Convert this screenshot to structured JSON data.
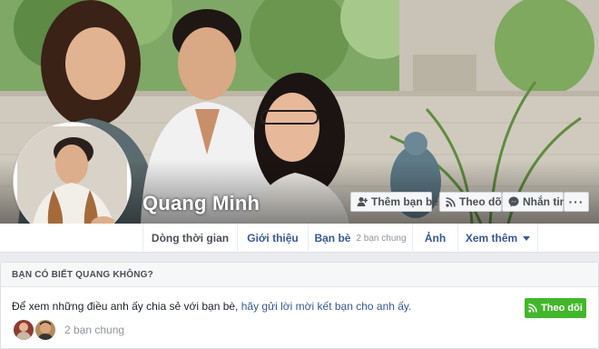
{
  "profile": {
    "name": "Quang Minh"
  },
  "actions": {
    "add_friend": "Thêm bạn bè",
    "follow": "Theo dõi",
    "message": "Nhắn tin",
    "more": "···"
  },
  "nav": {
    "timeline": "Dòng thời gian",
    "about": "Giới thiệu",
    "friends": "Bạn bè",
    "friends_sub": "2 bạn chung",
    "photos": "Ảnh",
    "more": "Xem thêm"
  },
  "card": {
    "title": "BẠN CÓ BIẾT QUANG KHÔNG?",
    "text_prefix": "Để xem những điều anh ấy chia sẻ với bạn bè, ",
    "text_link": "hãy gửi lời mời kết bạn cho anh ấy.",
    "follow_button": "Theo dõi",
    "mutual_text": "2 bạn chung"
  },
  "icons": {
    "add_friend": "add-friend-icon",
    "follow": "rss-follow-icon",
    "message": "messenger-icon",
    "caret": "caret-down-icon"
  },
  "colors": {
    "link": "#365899",
    "follow_green": "#42b72a",
    "page_bg": "#e9ebee"
  }
}
